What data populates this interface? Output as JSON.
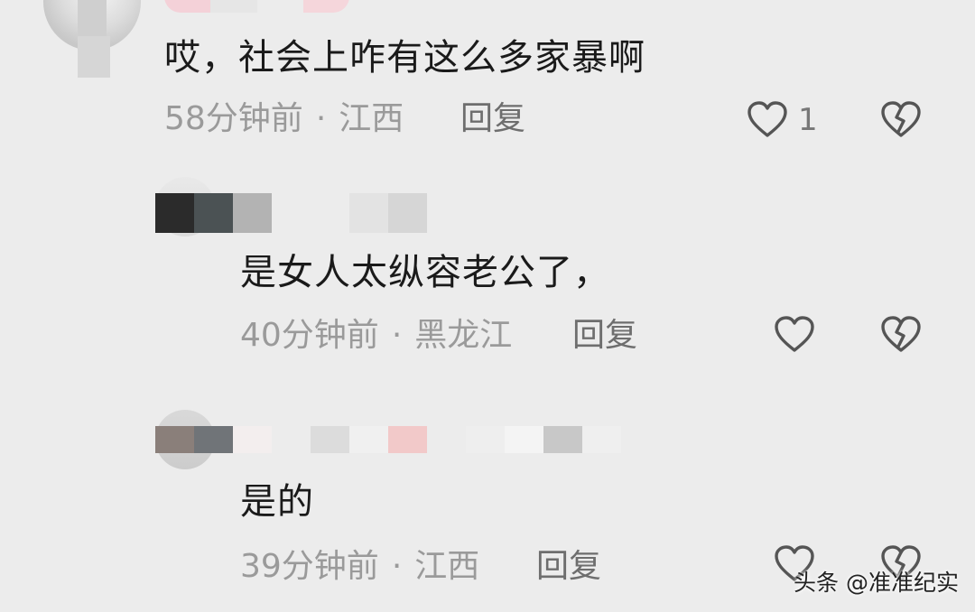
{
  "comments": [
    {
      "text": "哎，社会上咋有这么多家暴啊",
      "time": "58分钟前",
      "separator": "·",
      "location": "江西",
      "reply_label": "回复",
      "like_count": "1"
    },
    {
      "text": "是女人太纵容老公了，",
      "time": "40分钟前",
      "separator": "·",
      "location": "黑龙江",
      "reply_label": "回复"
    },
    {
      "text": "是的",
      "time": "39分钟前",
      "separator": "·",
      "location": "江西",
      "reply_label": "回复"
    }
  ],
  "watermark": "头条 @准准纪实",
  "icons": {
    "like": "heart-outline-icon",
    "dislike": "broken-heart-icon"
  },
  "colors": {
    "background": "#ececec",
    "text": "#1a1a1a",
    "meta": "#9a9a9a",
    "name_pink": "#f2b8c2"
  }
}
